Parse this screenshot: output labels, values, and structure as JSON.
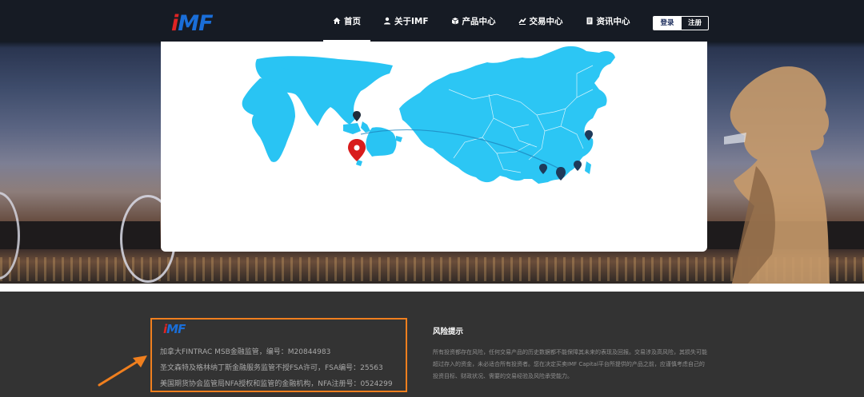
{
  "logo": {
    "text_i": "i",
    "text_rest": "MF"
  },
  "nav": {
    "items": [
      {
        "label": "首页",
        "icon": "home-icon",
        "active": true
      },
      {
        "label": "关于IMF",
        "icon": "user-icon",
        "active": false
      },
      {
        "label": "产品中心",
        "icon": "box-icon",
        "active": false
      },
      {
        "label": "交易中心",
        "icon": "trade-icon",
        "active": false
      },
      {
        "label": "资讯中心",
        "icon": "news-icon",
        "active": false
      }
    ],
    "login_label": "登录",
    "register_label": "注册"
  },
  "colors": {
    "brand_blue": "#1a6ed8",
    "brand_red": "#e02424",
    "map_blue": "#27c3f2",
    "highlight_orange": "#f07f1e"
  },
  "footer": {
    "logo": {
      "text_i": "i",
      "text_rest": "MF"
    },
    "regulation": [
      "加拿大FINTRAC MSB金融监管，编号：M20844983",
      "圣文森特及格林纳丁斯金融服务监管不授FSA许可，FSA编号：25563",
      "美国期货协会监管局NFA授权和监管的金融机构，NFA注册号：0524299"
    ],
    "risk_title": "风险提示",
    "risk_text": "所有投资都存在风险，任何交易产品的历史数据都不能保障其未来的表现及回报。交易涉及高风险，其损失可能超过存入的资金，未必适合所有投资者。您在决定买卖IMF Capital平台所提供的产品之前，应谨慎考虑自己的投资目标、财政状况、需要的交易经验及风险承受能力。"
  }
}
